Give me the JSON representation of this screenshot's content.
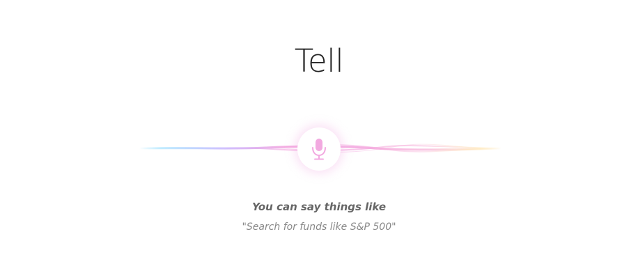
{
  "prompt": {
    "title": "Tell"
  },
  "voice": {
    "mic_icon": "microphone-icon",
    "accent_color": "#f0a8e0",
    "wave_colors": [
      "#a8e4ff",
      "#c9b8ff",
      "#f3a6df",
      "#f7b3d8",
      "#ffe2a8"
    ]
  },
  "hint": {
    "title": "You can say things like",
    "example": "\"Search for funds like S&P 500\""
  }
}
